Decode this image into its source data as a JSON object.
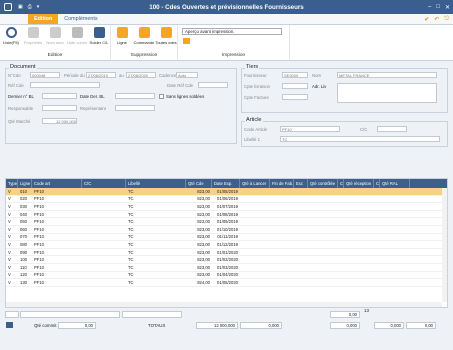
{
  "window": {
    "title": "100 - Cdes Ouvertes et prévisionnelles Fournisseurs"
  },
  "tabs": [
    {
      "label": "Edition"
    },
    {
      "label": "Compléments"
    }
  ],
  "ribbon": {
    "edition": {
      "label": "Edition",
      "buttons": [
        {
          "label": "Liste(F5)"
        },
        {
          "label": "Propriétés"
        },
        {
          "label": "Nom auto"
        },
        {
          "label": "Liste comm"
        },
        {
          "label": "Solder C/L"
        }
      ]
    },
    "suppression": {
      "label": "Suppression",
      "buttons": [
        {
          "label": "Ligne"
        },
        {
          "label": "Commande"
        },
        {
          "label": "Toutes cdes"
        }
      ]
    },
    "impression": {
      "label": "Impression",
      "select": "Aperçu avant impression."
    }
  },
  "document": {
    "title": "Document",
    "no_cde_label": "N°Cde",
    "no_cde": "000048",
    "periode_label": "Période du",
    "du": "27/08/2019",
    "au_label": "au",
    "au": "27/08/2020",
    "cadence_label": "Cadence",
    "cadence": "Auto",
    "ref_cde_label": "Réf Cde",
    "date_ref_label": "Date Réf Cde",
    "dernier_bl_label": "Dernier n° BL",
    "date_der_bl_label": "Date Der. BL",
    "sans_lignes_label": "Sans lignes soldées",
    "responsable_label": "Responsable",
    "representant_label": "Représentant",
    "qte_marche_label": "Qté Marché",
    "qte_marche": "12 000,000"
  },
  "tiers": {
    "title": "Tiers",
    "fournisseur_label": "Fournisseur",
    "fournisseur_code": "SE3000",
    "nom_label": "Nom",
    "nom": "METAL FRANCE",
    "cpte_livraison_label": "Cpte livraison",
    "adr_liv_label": "Adr. Liv",
    "cpte_facture_label": "Cpte Facture"
  },
  "article": {
    "title": "Article",
    "code_label": "Code Article",
    "code": "PF10",
    "cc_label": "C/C",
    "libelle_label": "Libellé 1",
    "libelle": "TC"
  },
  "grid": {
    "columns": [
      "Type",
      "Ligne",
      "Code art",
      "C/C",
      "Libellé",
      "Qté Cde",
      "Date Exp.",
      "Qté à Lancer",
      "Fin de Fab.",
      "Exc",
      "Qté contrôlée",
      "CA",
      "Qté réception",
      "CA",
      "Qté RAL"
    ],
    "rows": [
      [
        "V",
        "010",
        "PF10",
        "",
        "TC",
        "823,00",
        "01/05/2019"
      ],
      [
        "V",
        "020",
        "PF10",
        "",
        "TC",
        "823,00",
        "01/06/2019"
      ],
      [
        "V",
        "030",
        "PF10",
        "",
        "TC",
        "823,00",
        "01/07/2019"
      ],
      [
        "V",
        "040",
        "PF10",
        "",
        "TC",
        "823,00",
        "01/08/2019"
      ],
      [
        "V",
        "050",
        "PF10",
        "",
        "TC",
        "823,00",
        "01/09/2019"
      ],
      [
        "V",
        "060",
        "PF10",
        "",
        "TC",
        "823,00",
        "01/10/2019"
      ],
      [
        "V",
        "070",
        "PF10",
        "",
        "TC",
        "823,00",
        "01/11/2019"
      ],
      [
        "V",
        "080",
        "PF10",
        "",
        "TC",
        "823,00",
        "01/12/2019"
      ],
      [
        "V",
        "090",
        "PF10",
        "",
        "TC",
        "823,00",
        "01/01/2020"
      ],
      [
        "V",
        "100",
        "PF10",
        "",
        "TC",
        "823,00",
        "01/02/2020"
      ],
      [
        "V",
        "110",
        "PF10",
        "",
        "TC",
        "823,00",
        "01/03/2020"
      ],
      [
        "V",
        "120",
        "PF10",
        "",
        "TC",
        "823,00",
        "01/04/2020"
      ],
      [
        "V",
        "130",
        "PF10",
        "",
        "TC",
        "924,00",
        "01/05/2020"
      ]
    ]
  },
  "footer": {
    "qte_commit_label": "Qté commit",
    "qte_commit": "0,00",
    "totaux_label": "TOTAUX",
    "total_cde": "12 000,000",
    "total_lancer": "0,000",
    "total_ctrl": "0,000",
    "total_rec": "0,000",
    "total_ral": "0,00",
    "count": "13"
  }
}
